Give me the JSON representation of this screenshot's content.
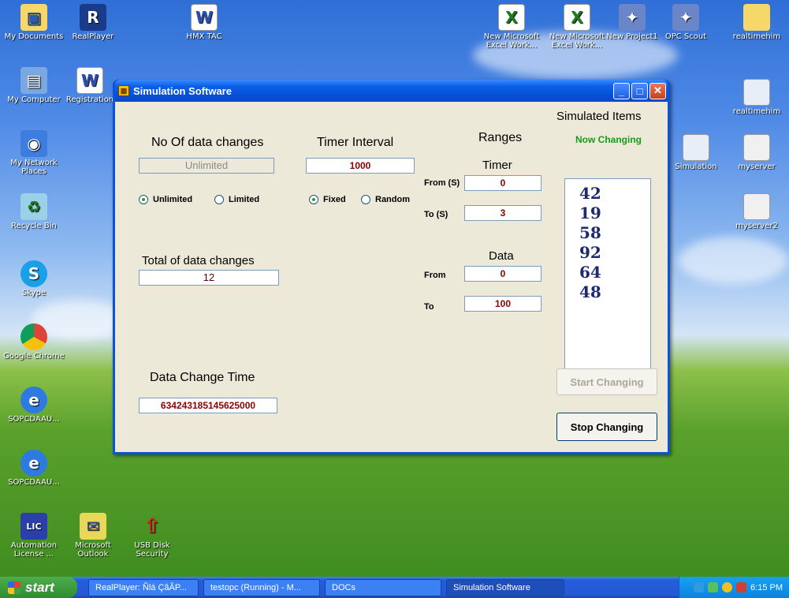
{
  "desktop": {
    "icons": [
      {
        "label": "My Documents"
      },
      {
        "label": "RealPlayer"
      },
      {
        "label": "HMX TAC"
      },
      {
        "label": "New Microsoft Excel Work..."
      },
      {
        "label": "New Microsoft Excel Work..."
      },
      {
        "label": "New Project1"
      },
      {
        "label": "OPC Scout"
      },
      {
        "label": "realtimehim"
      },
      {
        "label": "My Computer"
      },
      {
        "label": "Registration"
      },
      {
        "label": "realtimehim"
      },
      {
        "label": "My Network Places"
      },
      {
        "label": "Simulation"
      },
      {
        "label": "myserver"
      },
      {
        "label": "Recycle Bin"
      },
      {
        "label": "myserver2"
      },
      {
        "label": "Skype"
      },
      {
        "label": "Google Chrome"
      },
      {
        "label": "SOPCDAAU..."
      },
      {
        "label": "SOPCDAAU..."
      },
      {
        "label": "Automation License ..."
      },
      {
        "label": "Microsoft Outlook"
      },
      {
        "label": "USB Disk Security"
      }
    ]
  },
  "window": {
    "title": "Simulation Software",
    "no_of_changes": {
      "heading": "No Of data changes",
      "value": "Unlimited",
      "radio_unlimited": "Unlimited",
      "radio_limited": "Limited",
      "selected": "Unlimited"
    },
    "timer_interval": {
      "heading": "Timer Interval",
      "value": "1000",
      "radio_fixed": "Fixed",
      "radio_random": "Random",
      "selected": "Fixed"
    },
    "ranges": {
      "heading": "Ranges",
      "timer_heading": "Timer",
      "from_label": "From (S)",
      "from_value": "0",
      "to_label": "To (S)",
      "to_value": "3",
      "data_heading": "Data",
      "data_from_label": "From",
      "data_from_value": "0",
      "data_to_label": "To",
      "data_to_value": "100"
    },
    "total_changes": {
      "heading": "Total of data changes",
      "value": "12"
    },
    "data_change_time": {
      "heading": "Data Change Time",
      "value": "634243185145625000"
    },
    "simulated": {
      "heading": "Simulated Items",
      "status": "Now Changing",
      "items": [
        "42",
        "19",
        "58",
        "92",
        "64",
        "48"
      ]
    },
    "buttons": {
      "start": "Start Changing",
      "stop": "Stop Changing"
    }
  },
  "taskbar": {
    "start_label": "start",
    "tasks": [
      {
        "label": "RealPlayer: Ñlá ÇâÂP..."
      },
      {
        "label": "testopc (Running) - M..."
      },
      {
        "label": "DOCs"
      },
      {
        "label": "Simulation Software"
      }
    ],
    "clock": "6:15 PM"
  }
}
